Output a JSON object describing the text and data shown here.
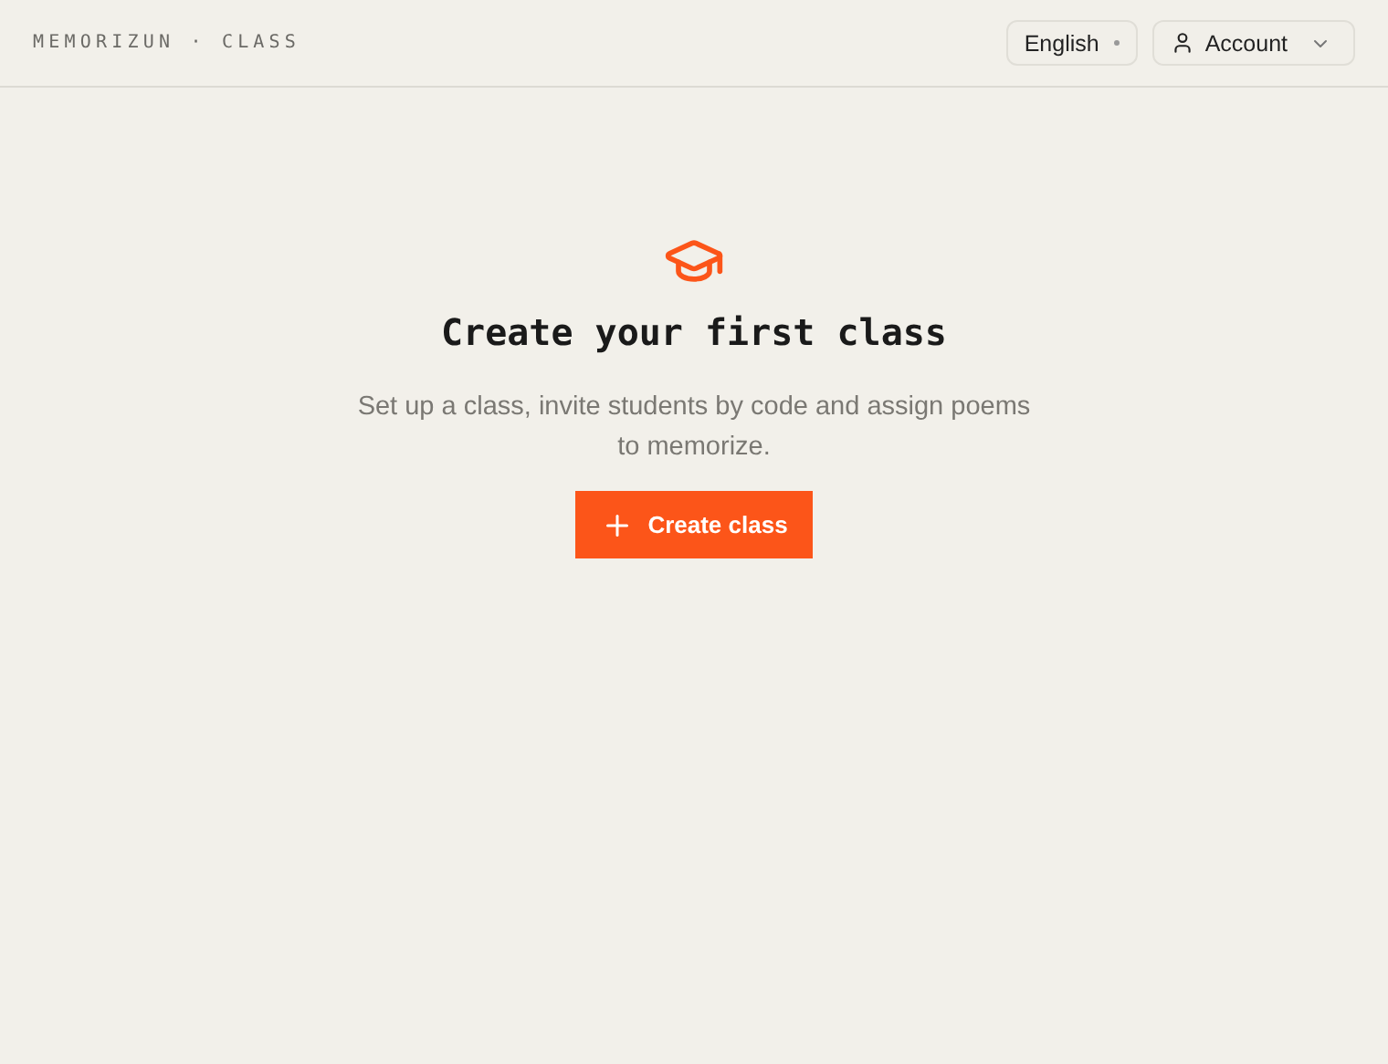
{
  "header": {
    "brand": "MEMORIZUN · CLASS",
    "language": {
      "label": "English"
    },
    "account": {
      "label": "Account"
    }
  },
  "empty_state": {
    "title": "Create your first class",
    "description": "Set up a class, invite students by code and assign poems to memorize.",
    "button": "Create class"
  }
}
